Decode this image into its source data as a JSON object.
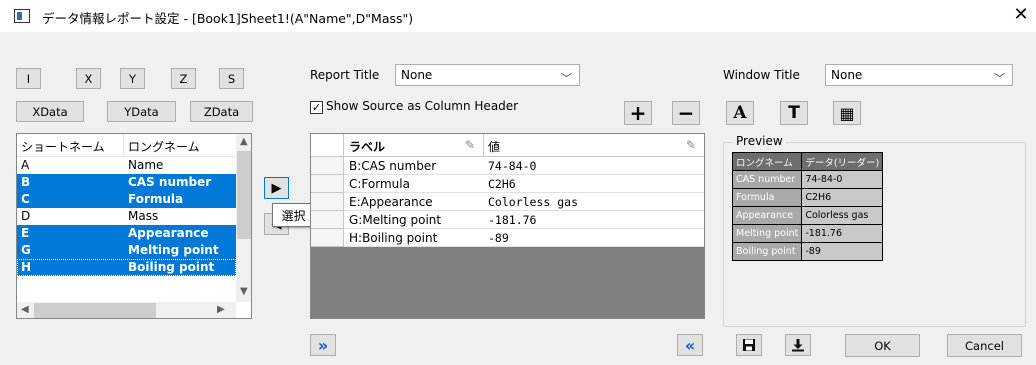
{
  "window": {
    "title": "データ情報レポート設定 - [Book1]Sheet1!(A\"Name\",D\"Mass\")",
    "close_glyph": "✕"
  },
  "axis_buttons": [
    "I",
    "X",
    "Y",
    "Z",
    "S"
  ],
  "data_buttons": [
    "XData",
    "YData",
    "ZData"
  ],
  "column_list": {
    "headers": [
      "ショートネーム",
      "ロングネーム"
    ],
    "rows": [
      {
        "short": "A",
        "long": "Name",
        "selected": false
      },
      {
        "short": "B",
        "long": "CAS number",
        "selected": true
      },
      {
        "short": "C",
        "long": "Formula",
        "selected": true
      },
      {
        "short": "D",
        "long": "Mass",
        "selected": false
      },
      {
        "short": "E",
        "long": "Appearance",
        "selected": true
      },
      {
        "short": "G",
        "long": "Melting point",
        "selected": true
      },
      {
        "short": "H",
        "long": "Boiling point",
        "selected": true
      }
    ]
  },
  "move_right_glyph": "▶",
  "move_left_glyph": "◀",
  "tooltip": "選択",
  "report_title": {
    "label": "Report Title",
    "value": "None"
  },
  "show_source": {
    "label": "Show Source as Column Header",
    "checked": true
  },
  "grid": {
    "headers": [
      "ラベル",
      "値"
    ],
    "rows": [
      {
        "label": "B:CAS number",
        "value": "74-84-0"
      },
      {
        "label": "C:Formula",
        "value": "C2H6"
      },
      {
        "label": "E:Appearance",
        "value": "Colorless gas"
      },
      {
        "label": "G:Melting point",
        "value": "-181.76"
      },
      {
        "label": "H:Boiling point",
        "value": "-89"
      }
    ]
  },
  "add_glyph": "+",
  "remove_glyph": "−",
  "window_title": {
    "label": "Window Title",
    "value": "None"
  },
  "format_buttons": {
    "font": "A",
    "text": "T",
    "table": "▦"
  },
  "preview": {
    "label": "Preview",
    "headers": [
      "ロングネーム",
      "データ(リーダー)"
    ],
    "rows": [
      [
        "CAS number",
        "74-84-0"
      ],
      [
        "Formula",
        "C2H6"
      ],
      [
        "Appearance",
        "Colorless gas"
      ],
      [
        "Melting point",
        "-181.76"
      ],
      [
        "Boiling point",
        "-89"
      ]
    ]
  },
  "expand_glyph": "»",
  "collapse_glyph": "«",
  "footer": {
    "ok": "OK",
    "cancel": "Cancel"
  },
  "colors": {
    "selection": "#0078d7",
    "accent_icons": "#0b57c9"
  }
}
